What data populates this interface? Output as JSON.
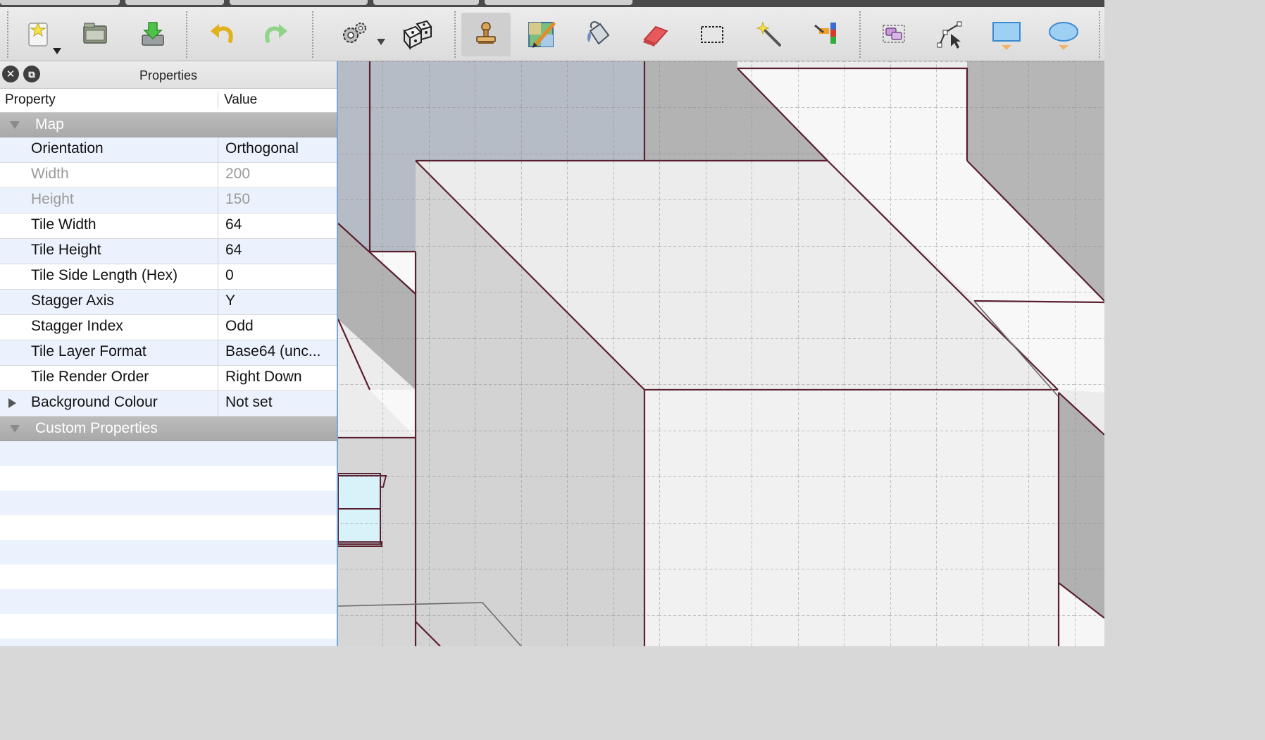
{
  "toolbar": {
    "buttons": [
      {
        "id": "new-map",
        "icon": "new-document-icon"
      },
      {
        "id": "open",
        "icon": "open-folder-icon"
      },
      {
        "id": "save",
        "icon": "save-download-icon"
      },
      {
        "id": "undo",
        "icon": "undo-arrow-icon"
      },
      {
        "id": "redo",
        "icon": "redo-arrow-icon"
      },
      {
        "id": "commands",
        "icon": "gears-icon"
      },
      {
        "id": "random-mode",
        "icon": "dice-icon"
      },
      {
        "id": "stamp-brush",
        "icon": "stamp-icon"
      },
      {
        "id": "terrain-brush",
        "icon": "terrain-brush-icon"
      },
      {
        "id": "bucket-fill",
        "icon": "paint-bucket-icon"
      },
      {
        "id": "eraser",
        "icon": "eraser-icon"
      },
      {
        "id": "rectangular-select",
        "icon": "rectangle-select-icon"
      },
      {
        "id": "magic-wand",
        "icon": "magic-wand-icon"
      },
      {
        "id": "select-same-tile",
        "icon": "select-same-tile-icon"
      },
      {
        "id": "select-objects",
        "icon": "select-objects-icon"
      },
      {
        "id": "edit-polygons",
        "icon": "edit-polygons-icon"
      },
      {
        "id": "insert-rectangle",
        "icon": "insert-rectangle-icon"
      },
      {
        "id": "insert-ellipse",
        "icon": "insert-ellipse-icon"
      }
    ]
  },
  "panel": {
    "title": "Properties",
    "col_property": "Property",
    "col_value": "Value",
    "group_map": "Map",
    "group_custom": "Custom Properties",
    "rows": [
      {
        "key": "Orientation",
        "value": "Orthogonal",
        "disabled": false
      },
      {
        "key": "Width",
        "value": "200",
        "disabled": true
      },
      {
        "key": "Height",
        "value": "150",
        "disabled": true
      },
      {
        "key": "Tile Width",
        "value": "64",
        "disabled": false
      },
      {
        "key": "Tile Height",
        "value": "64",
        "disabled": false
      },
      {
        "key": "Tile Side Length (Hex)",
        "value": "0",
        "disabled": false
      },
      {
        "key": "Stagger Axis",
        "value": "Y",
        "disabled": false
      },
      {
        "key": "Stagger Index",
        "value": "Odd",
        "disabled": false
      },
      {
        "key": "Tile Layer Format",
        "value": "Base64 (unc...",
        "disabled": false
      },
      {
        "key": "Tile Render Order",
        "value": "Right Down",
        "disabled": false
      },
      {
        "key": "Background Colour",
        "value": "Not set",
        "disabled": false
      }
    ]
  },
  "colors": {
    "accent_border": "#7aa7d8",
    "wall_line": "#5a1f2e",
    "row_alt": "#ecf2fd"
  }
}
